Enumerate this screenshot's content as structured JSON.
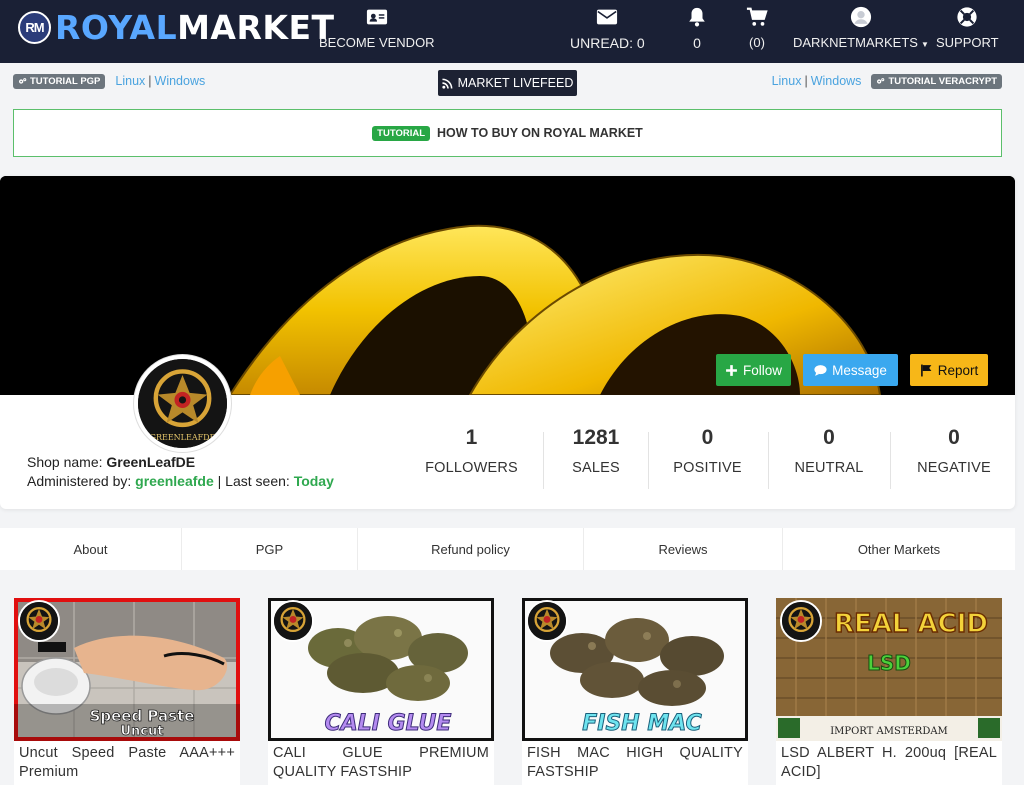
{
  "navbar": {
    "brand_badge": "RM",
    "brand_royal": "ROYAL",
    "brand_market": "MARKET",
    "become_vendor": "BECOME VENDOR",
    "unread": "UNREAD: 0",
    "notifications": "0",
    "cart": "(0)",
    "user": "DARKNETMARKETS",
    "support": "SUPPORT"
  },
  "tutorials": {
    "pgp_badge": "TUTORIAL PGP",
    "pgp_linux": "Linux",
    "pgp_windows": "Windows",
    "livefeed": "MARKET LIVEFEED",
    "vc_linux": "Linux",
    "vc_windows": "Windows",
    "vc_badge": "TUTORIAL VERACRYPT",
    "howto_badge": "TUTORIAL",
    "howto_text": "HOW TO BUY ON ROYAL MARKET"
  },
  "profile": {
    "avatar_caption": "GREENLEAFDE",
    "follow": "Follow",
    "message": "Message",
    "report": "Report",
    "shop_name_label": "Shop name:",
    "shop_name": "GreenLeafDE",
    "admin_label": "Administered by:",
    "admin": "greenleafde",
    "last_seen_label": "| Last seen:",
    "last_seen": "Today",
    "stats": [
      {
        "value": "1",
        "label": "FOLLOWERS"
      },
      {
        "value": "1281",
        "label": "SALES"
      },
      {
        "value": "0",
        "label": "POSITIVE"
      },
      {
        "value": "0",
        "label": "NEUTRAL"
      },
      {
        "value": "0",
        "label": "NEGATIVE"
      }
    ]
  },
  "tabs": [
    "About",
    "PGP",
    "Refund policy",
    "Reviews",
    "Other Markets"
  ],
  "products": [
    {
      "title": "Uncut Speed Paste AAA+++ Premium",
      "img_text": "Speed Paste Uncut",
      "img_text_line1": "Speed Paste",
      "img_text_line2": "Uncut"
    },
    {
      "title": "CALI GLUE PREMIUM QUALITY FASTSHIP",
      "img_text": "CALI GLUE"
    },
    {
      "title": "FISH MAC HIGH QUALITY FASTSHIP",
      "img_text": "FISH MAC"
    },
    {
      "title": "LSD ALBERT H. 200uq [REAL ACID]",
      "img_text": "REAL ACID",
      "img_sub": "LSD",
      "img_footer": "IMPORT AMSTERDAM"
    }
  ],
  "colors": {
    "navbar_bg": "#1a2035",
    "brand_blue": "#59a7ff",
    "follow_green": "#28a745",
    "message_blue": "#3aa8ef",
    "report_yellow": "#f7b718"
  }
}
